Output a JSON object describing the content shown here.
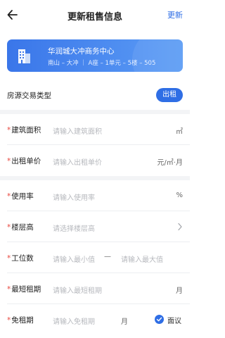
{
  "header": {
    "title": "更新租售信息",
    "action_label": "更新"
  },
  "card": {
    "title": "华润城大冲商务中心",
    "subtitle": "南山 – 大冲 ｜ A座 – 1单元 – 5楼 – 505"
  },
  "transaction": {
    "label": "房源交易类型",
    "selected": "出租"
  },
  "rows": {
    "area": {
      "required": "*",
      "label": "建筑面积",
      "placeholder": "请输入建筑面积",
      "unit": "㎡"
    },
    "price": {
      "required": "*",
      "label": "出租单价",
      "placeholder": "请输入出租单价",
      "unit": "元/㎡·月"
    },
    "usage": {
      "required": "*",
      "label": "使用率",
      "placeholder": "请输入使用率",
      "unit": "%"
    },
    "floor": {
      "required": "*",
      "label": "楼层高",
      "placeholder": "请选择楼层高"
    },
    "stations": {
      "required": "*",
      "label": "工位数",
      "min_placeholder": "请输入最小值",
      "separator": "—",
      "max_placeholder": "请输入最大值"
    },
    "min_lease": {
      "required": "*",
      "label": "最短租期",
      "placeholder": "请输入最短租期",
      "unit": "月"
    },
    "free_lease": {
      "required": "*",
      "label": "免租期",
      "placeholder": "请输入免租期",
      "unit": "月",
      "negotiable_label": "面议"
    }
  },
  "colors": {
    "accent": "#2f6ee5",
    "required": "#e8453c"
  }
}
